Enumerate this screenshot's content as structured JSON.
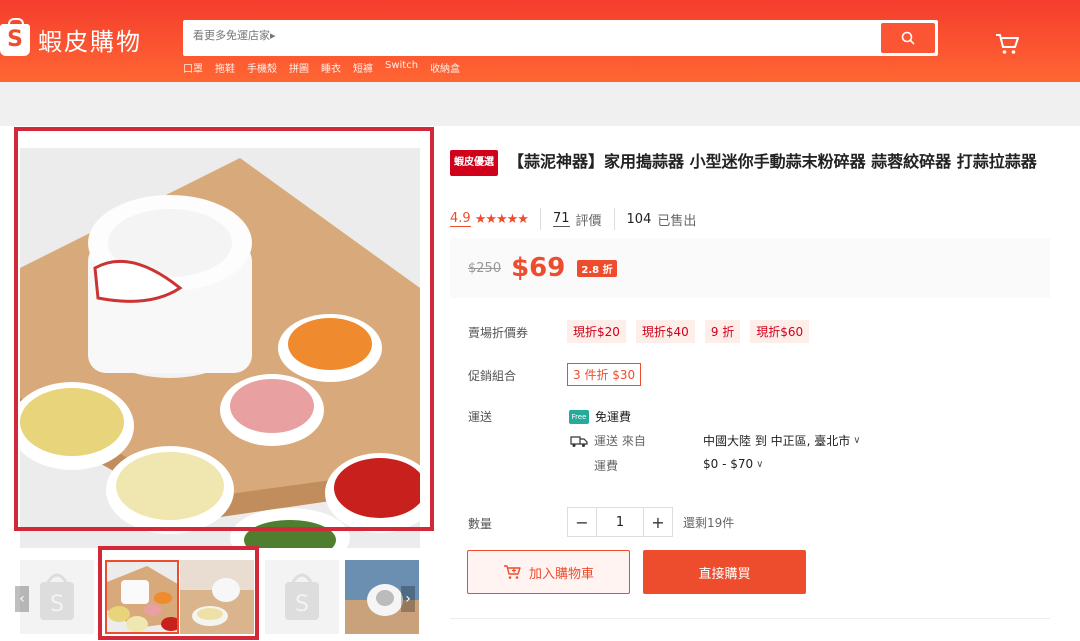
{
  "header": {
    "logo_text": "蝦皮購物",
    "search_placeholder": "看更多免運店家▸",
    "hot_words": [
      "口罩",
      "拖鞋",
      "手機殼",
      "拼圖",
      "睡衣",
      "短褲",
      "Switch",
      "收納盒"
    ]
  },
  "product": {
    "badge": "蝦皮優選",
    "title": "【蒜泥神器】家用搗蒜器 小型迷你手動蒜末粉碎器 蒜蓉絞碎器 打蒜拉蒜器",
    "rating": "4.9",
    "stars": "★★★★★",
    "reviews_count": "71",
    "reviews_label": "評價",
    "sold_count": "104",
    "sold_label": "已售出",
    "original_price": "$250",
    "price": "$69",
    "discount": "2.8 折"
  },
  "vouchers": {
    "label": "賣場折價券",
    "items": [
      "現折$20",
      "現折$40",
      "9 折",
      "現折$60"
    ]
  },
  "combo": {
    "label": "促銷組合",
    "value": "3 件折 $30"
  },
  "shipping": {
    "label": "運送",
    "free_icon": "Free",
    "free_text": "免運費",
    "from_label": "運送 來自",
    "route": "中國大陸 到 中正區, 臺北市",
    "fee_label": "運費",
    "fee_range": "$0 - $70"
  },
  "quantity": {
    "label": "數量",
    "value": "1",
    "stock": "還剩19件"
  },
  "actions": {
    "add_to_cart": "加入購物車",
    "buy_now": "直接購買"
  },
  "colors": {
    "brand": "#ee4d2d",
    "highlight": "#d1283a"
  }
}
